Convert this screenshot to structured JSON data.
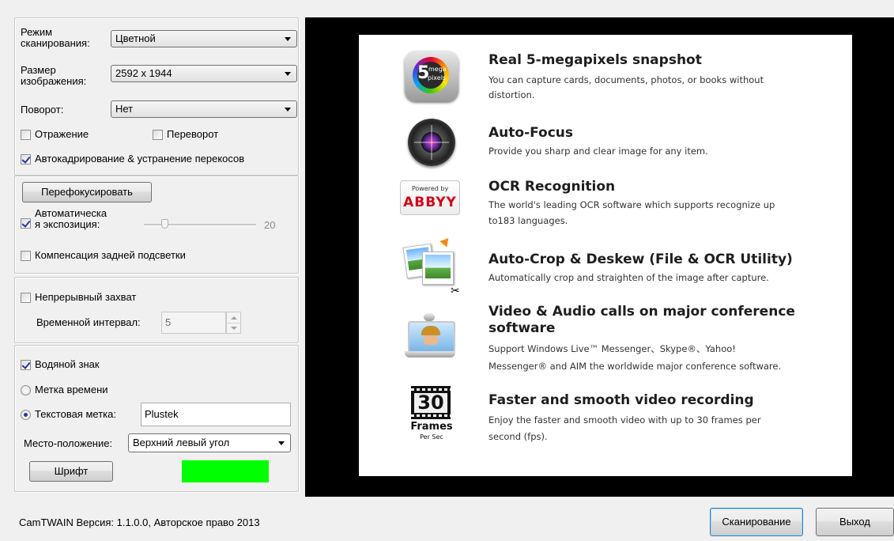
{
  "scan": {
    "mode_label": "Режим сканирования:",
    "mode_value": "Цветной",
    "size_label": "Размер изображения:",
    "size_value": "2592 x 1944",
    "rotate_label": "Поворот:",
    "rotate_value": "Нет",
    "mirror_label": "Отражение",
    "flip_label": "Переворот",
    "autocrop_label": "Автокадрирование & устранение перекосов"
  },
  "focus": {
    "refocus_label": "Перефокусировать",
    "autoexp_label_1": "Автоматическа",
    "autoexp_label_2": "я экспозиция:",
    "exposure_value": "20",
    "backlight_label": "Компенсация задней подсветки"
  },
  "capture": {
    "continuous_label": "Непрерывный захват",
    "interval_label": "Временной интервал:",
    "interval_value": "5"
  },
  "watermark": {
    "watermark_label": "Водяной знак",
    "timestamp_label": "Метка времени",
    "textmark_label": "Текстовая метка:",
    "textmark_value": "Plustek",
    "position_label": "Место-положение:",
    "position_value": "Верхний левый угол",
    "font_label": "Шрифт",
    "color": "#00ff00"
  },
  "preview": {
    "features": [
      {
        "title": "Real 5-megapixels snapshot",
        "desc1": "You can capture cards, documents, photos, or books without",
        "desc2": "distortion."
      },
      {
        "title": "Auto-Focus",
        "desc1": "Provide you sharp and clear image for any item.",
        "desc2": ""
      },
      {
        "title": "OCR Recognition",
        "desc1": "The world's leading OCR software which supports recognize up",
        "desc2": "to183 languages."
      },
      {
        "title": "Auto-Crop & Deskew (File & OCR Utility)",
        "desc1": "Automatically crop and straighten of the image after capture.",
        "desc2": ""
      },
      {
        "title1": "Video & Audio calls on major conference",
        "title2": "software",
        "desc1": "Support Windows Live™ Messenger、Skype®、Yahoo!",
        "desc2": "Messenger® and AIM the worldwide major conference software."
      },
      {
        "title": "Faster and smooth video recording",
        "desc1": "Enjoy the faster and smooth video with up to 30 frames per",
        "desc2": "second (fps)."
      }
    ],
    "icon_megapixel_top": "mega",
    "icon_megapixel_bottom": "pixels",
    "icon_megapixel_num": "5",
    "icon_ocr_small": "Powered by",
    "icon_ocr_big": "ABBYY",
    "icon_frames_num": "30",
    "icon_frames_label": "Frames",
    "icon_frames_sub": "Per Sec"
  },
  "footer": {
    "version_text": "CamTWAIN Версия: 1.1.0.0, Авторское право 2013",
    "scan_button": "Сканирование",
    "exit_button": "Выход"
  }
}
